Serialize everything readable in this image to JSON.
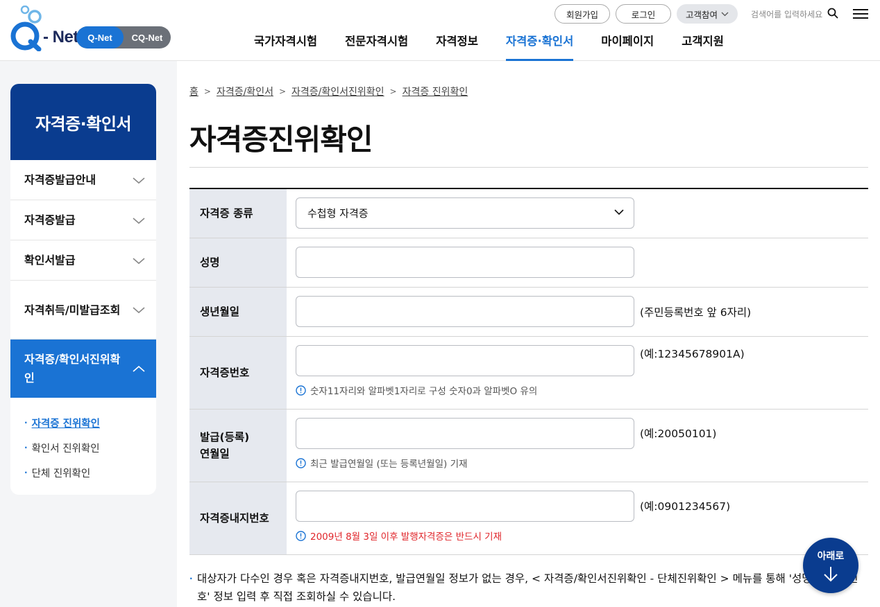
{
  "header": {
    "logo_text": "Q-Net",
    "site_toggle": [
      "Q-Net",
      "CQ-Net"
    ],
    "util": {
      "join": "회원가입",
      "login": "로그인",
      "customer": "고객참여"
    },
    "search_placeholder": "검색어를 입력하세요",
    "nav": [
      "국가자격시험",
      "전문자격시험",
      "자격정보",
      "자격증·확인서",
      "마이페이지",
      "고객지원"
    ]
  },
  "sidebar": {
    "title": "자격증·확인서",
    "items": [
      "자격증발급안내",
      "자격증발급",
      "확인서발급",
      "자격취득/미발급조회",
      "자격증/확인서진위확인"
    ],
    "subitems": [
      "자격증 진위확인",
      "확인서 진위확인",
      "단체 진위확인"
    ]
  },
  "breadcrumb": [
    "홈",
    "자격증/확인서",
    "자격증/확인서진위확인",
    "자격증 진위확인"
  ],
  "page_title": "자격증진위확인",
  "form": {
    "type_label": "자격증 종류",
    "type_value": "수첩형 자격증",
    "name_label": "성명",
    "birth_label": "생년월일",
    "birth_hint": "(주민등록번호 앞 6자리)",
    "cert_no_label": "자격증번호",
    "cert_no_hint": "(예:12345678901A)",
    "cert_no_note": "숫자11자리와 알파벳1자리로 구성 숫자0과 알파벳O 유의",
    "issue_label_1": "발급(등록)",
    "issue_label_2": "연월일",
    "issue_hint": "(예:20050101)",
    "issue_note": "최근 발급연월일 (또는 등록년월일) 기재",
    "inner_no_label": "자격증내지번호",
    "inner_no_hint": "(예:0901234567)",
    "inner_no_note": "2009년 8월 3일 이후 발행자격증은 반드시 기재"
  },
  "bottom_note": "대상자가 다수인 경우 혹은 자격증내지번호, 발급연월일 정보가 없는 경우, < 자격증/확인서진위확인 - 단체진위확인 > 메뉴를 통해 '성명, 자격증번호' 정보 입력 후 직접 조회하실 수 있습니다.",
  "fab_label": "아래로",
  "colors": {
    "primary": "#1a73d4",
    "navy": "#0a3c8f",
    "red": "#e0262b"
  }
}
